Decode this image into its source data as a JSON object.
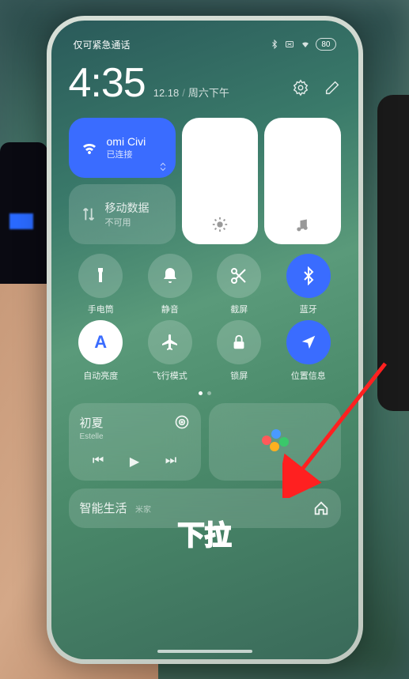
{
  "status": {
    "network": "仅可紧急通话",
    "battery": "80"
  },
  "clock": {
    "time": "4:35",
    "date": "12.18",
    "weekday": "周六下午"
  },
  "wifi": {
    "ssid": "omi Civi",
    "status": "已连接"
  },
  "mobile_data": {
    "label": "移动数据",
    "status": "不可用"
  },
  "toggles": {
    "flashlight": "手电筒",
    "mute": "静音",
    "screenshot": "截屏",
    "bluetooth": "蓝牙",
    "auto_brightness": "自动亮度",
    "airplane": "飞行模式",
    "lock": "锁屏",
    "location": "位置信息"
  },
  "music": {
    "title": "初夏",
    "artist": "Estelle"
  },
  "smart": {
    "title": "智能生活",
    "sub": "米家"
  },
  "overlay": "下拉"
}
